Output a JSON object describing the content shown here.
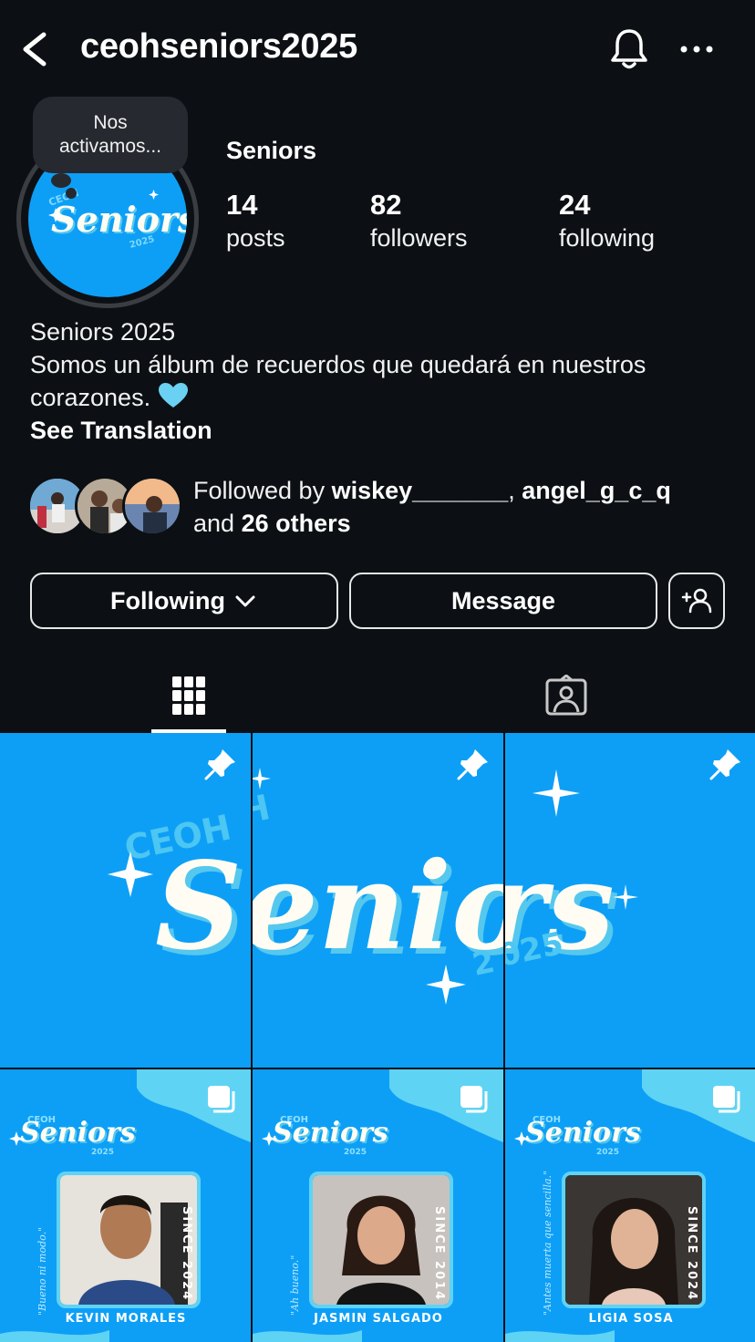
{
  "header": {
    "username": "ceohseniors2025"
  },
  "note": {
    "text": "Nos activamos..."
  },
  "profile": {
    "display_name": "Seniors",
    "stats": [
      {
        "value": "14",
        "label": "posts"
      },
      {
        "value": "82",
        "label": "followers"
      },
      {
        "value": "24",
        "label": "following"
      }
    ],
    "bio_line1": "Seniors 2025",
    "bio_line2": "Somos un álbum de recuerdos que quedará en nuestros corazones.",
    "bio_emoji": "light-blue-heart",
    "see_translation": "See Translation"
  },
  "followed_by": {
    "prefix": "Followed by ",
    "user1": "wiskey_______",
    "separator": ", ",
    "user2": "angel_g_c_q",
    "and": "and ",
    "others": "26 others"
  },
  "actions": {
    "following_label": "Following",
    "message_label": "Message"
  },
  "grid": {
    "banner_ceoh": "CEOH",
    "banner_seniors": "Seniors",
    "banner_year": "2025",
    "cards": [
      {
        "name": "KEVIN MORALES",
        "since": "SINCE 2024",
        "quote": "\"Bueno ni modo.\""
      },
      {
        "name": "JASMIN SALGADO",
        "since": "SINCE 2014",
        "quote": "\"Ah bueno.\""
      },
      {
        "name": "LIGIA SOSA",
        "since": "SINCE 2024",
        "quote": "\"Antes muerta que sencilla.\""
      }
    ],
    "card_logo": "Seniors",
    "card_ceoh": "CEOH",
    "card_year": "2025"
  },
  "colors": {
    "background": "#0c1014",
    "brand_blue": "#0d9ff6",
    "accent_cyan": "#5fd3f4"
  }
}
